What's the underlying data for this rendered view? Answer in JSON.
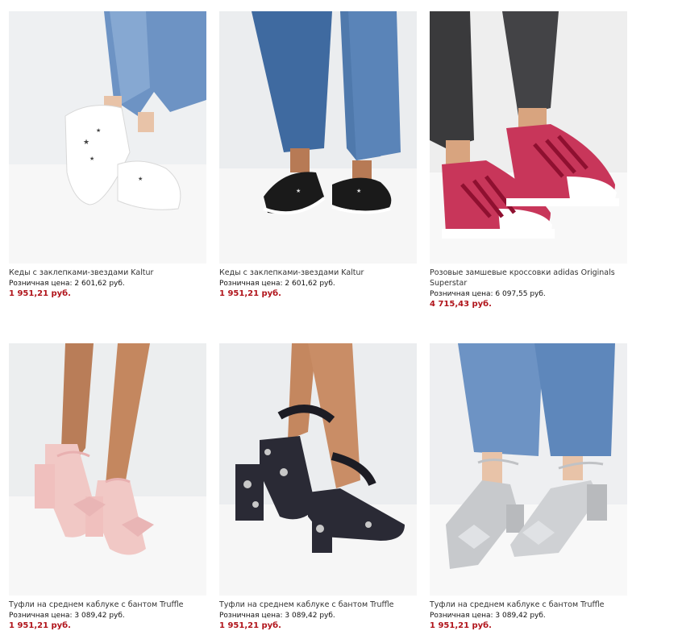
{
  "products": [
    {
      "image": "white-star-studded-sneakers",
      "name": "Кеды с заклепками-звездами Kaltur",
      "retail_price": "Розничная цена: 2 601,62 руб.",
      "sale_price": "1 951,21 руб."
    },
    {
      "image": "black-star-studded-sneakers",
      "name": "Кеды с заклепками-звездами Kaltur",
      "retail_price": "Розничная цена: 2 601,62 руб.",
      "sale_price": "1 951,21 руб."
    },
    {
      "image": "pink-suede-adidas-superstar",
      "name": "Розовые замшевые кроссовки adidas Originals Superstar",
      "retail_price": "Розничная цена: 6 097,55 руб.",
      "sale_price": "4 715,43 руб."
    },
    {
      "image": "pink-lace-block-heel-bow-shoes",
      "name": "Туфли на среднем каблуке с бантом Truffle",
      "retail_price": "Розничная цена: 3 089,42 руб.",
      "sale_price": "1 951,21 руб."
    },
    {
      "image": "black-floral-lace-up-block-heels",
      "name": "Туфли на среднем каблуке с бантом Truffle",
      "retail_price": "Розничная цена: 3 089,42 руб.",
      "sale_price": "1 951,21 руб."
    },
    {
      "image": "silver-block-heel-bow-shoes",
      "name": "Туфли на среднем каблуке с бантом Truffle",
      "retail_price": "Розничная цена: 3 089,42 руб.",
      "sale_price": "1 951,21 руб."
    }
  ],
  "colors": {
    "sale_price": "#b0131a",
    "photo_background": "#f2f2f2",
    "denim": "#5b86b8",
    "black_jeans": "#3a3a3c",
    "skin": "#c98d66"
  }
}
